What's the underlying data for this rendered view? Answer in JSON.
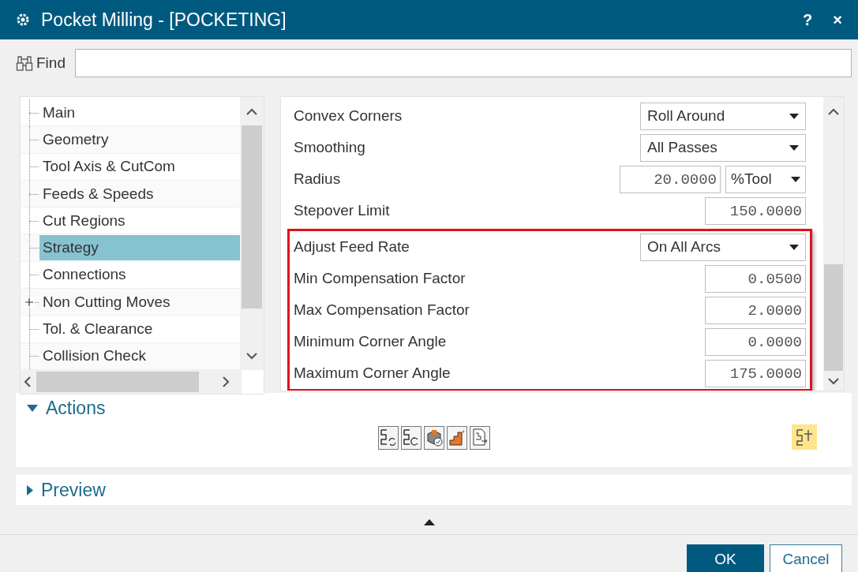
{
  "window": {
    "title": "Pocket Milling - [POCKETING]",
    "help": "?",
    "close": "×"
  },
  "find": {
    "label": "Find"
  },
  "tree": {
    "items": [
      {
        "label": "Main",
        "selected": false,
        "expandable": false
      },
      {
        "label": "Geometry",
        "selected": false,
        "expandable": false
      },
      {
        "label": "Tool Axis & CutCom",
        "selected": false,
        "expandable": false
      },
      {
        "label": "Feeds & Speeds",
        "selected": false,
        "expandable": false
      },
      {
        "label": "Cut Regions",
        "selected": false,
        "expandable": false
      },
      {
        "label": "Strategy",
        "selected": true,
        "expandable": false
      },
      {
        "label": "Connections",
        "selected": false,
        "expandable": false
      },
      {
        "label": "Non Cutting Moves",
        "selected": false,
        "expandable": true
      },
      {
        "label": "Tol. & Clearance",
        "selected": false,
        "expandable": false
      },
      {
        "label": "Collision Check",
        "selected": false,
        "expandable": false
      }
    ]
  },
  "parameters": {
    "groups": [
      {
        "highlighted": false,
        "rows": [
          {
            "kind": "dropdown",
            "label": "Convex Corners",
            "value": "Roll Around"
          },
          {
            "kind": "dropdown",
            "label": "Smoothing",
            "value": "All Passes"
          },
          {
            "kind": "number_unit",
            "label": "Radius",
            "value": "20.0000",
            "unit": "%Tool"
          },
          {
            "kind": "number",
            "label": "Stepover Limit",
            "value": "150.0000"
          }
        ]
      },
      {
        "highlighted": true,
        "rows": [
          {
            "kind": "dropdown",
            "label": "Adjust Feed Rate",
            "value": "On All Arcs"
          },
          {
            "kind": "number",
            "label": "Min Compensation Factor",
            "value": "0.0500"
          },
          {
            "kind": "number",
            "label": "Max Compensation Factor",
            "value": "2.0000"
          },
          {
            "kind": "number",
            "label": "Minimum Corner Angle",
            "value": "0.0000"
          },
          {
            "kind": "number",
            "label": "Maximum Corner Angle",
            "value": "175.0000"
          }
        ]
      }
    ]
  },
  "actions": {
    "title": "Actions",
    "expanded": true
  },
  "preview": {
    "title": "Preview",
    "expanded": false
  },
  "buttons": [
    {
      "label": "OK",
      "kind": "primary"
    },
    {
      "label": "Cancel",
      "kind": "secondary"
    }
  ]
}
